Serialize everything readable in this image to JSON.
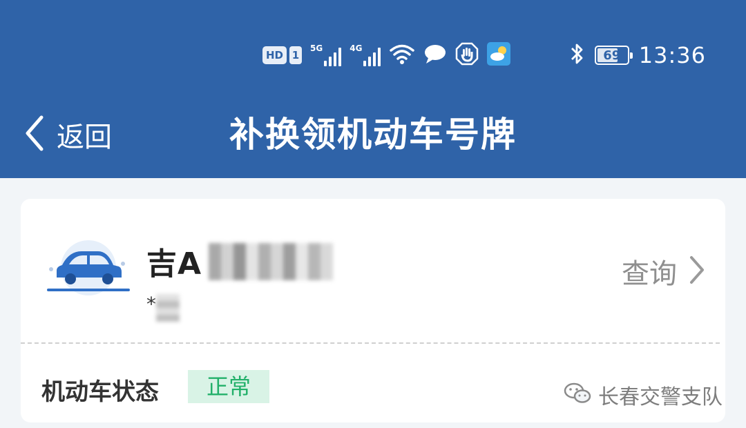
{
  "status_bar": {
    "hd_badge": "HD",
    "sim_badge": "1",
    "net_1": "5G",
    "net_2": "4G",
    "battery_level": "69",
    "time": "13:36"
  },
  "nav": {
    "back_label": "返回",
    "title": "补换领机动车号牌"
  },
  "vehicle": {
    "plate_visible": "吉A",
    "owner_visible": "*",
    "query_label": "查询"
  },
  "status": {
    "label": "机动车状态",
    "value": "正常"
  },
  "watermark": {
    "text": "长春交警支队"
  },
  "colors": {
    "header_bg": "#2f63a8",
    "status_ok_text": "#22b06a",
    "status_ok_bg": "#d9f3e6",
    "page_bg": "#f2f5f8"
  },
  "icons": [
    "hd-icon",
    "signal-5g-icon",
    "signal-4g-icon",
    "wifi-icon",
    "chat-bubble-icon",
    "hand-stop-icon",
    "weather-app-icon",
    "bluetooth-icon",
    "battery-icon",
    "chevron-left-icon",
    "car-icon",
    "chevron-right-icon",
    "wechat-icon"
  ]
}
